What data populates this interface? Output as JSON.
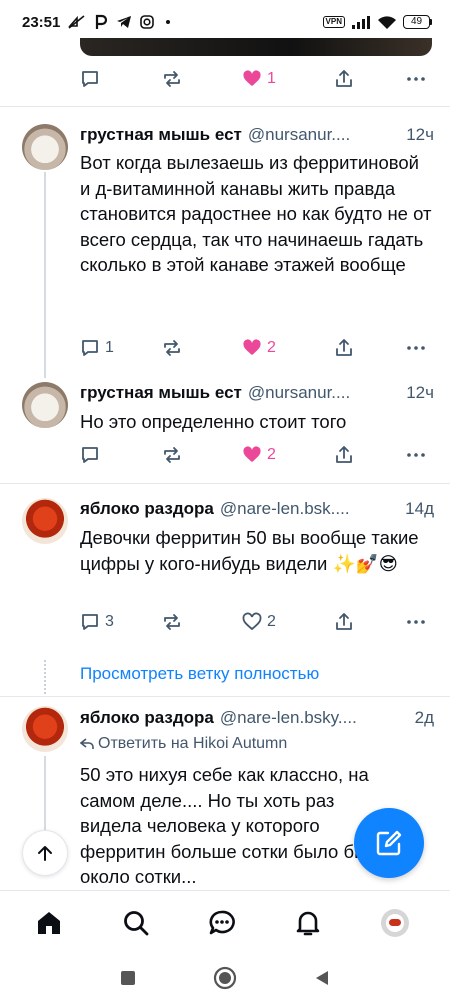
{
  "status_bar": {
    "time": "23:51",
    "vpn": "VPN",
    "battery": "49"
  },
  "posts": [
    {
      "actions": {
        "reply_count": "",
        "repost_count": "",
        "like_count": "1",
        "liked": true
      }
    },
    {
      "author": "грустная мышь ест",
      "handle": "@nursanur....",
      "time": "12ч",
      "text": "Вот когда вылезаешь из ферритиновой и д-витаминной канавы жить правда становится радостнее но как будто не от всего сердца, так что начинаешь гадать сколько в этой канаве этажей вообще",
      "actions": {
        "reply_count": "1",
        "repost_count": "",
        "like_count": "2",
        "liked": true
      }
    },
    {
      "author": "грустная мышь ест",
      "handle": "@nursanur....",
      "time": "12ч",
      "text": "Но это определенно стоит того",
      "actions": {
        "reply_count": "",
        "repost_count": "",
        "like_count": "2",
        "liked": true
      }
    },
    {
      "author": "яблоко раздора",
      "handle": "@nare-len.bsk....",
      "time": "14д",
      "text": "Девочки ферритин 50 вы вообще такие цифры у кого-нибудь видели ✨💅😎",
      "actions": {
        "reply_count": "3",
        "repost_count": "",
        "like_count": "2",
        "liked": false
      }
    },
    {
      "author": "яблоко раздора",
      "handle": "@nare-len.bsky....",
      "time": "2д",
      "reply_to": "Ответить на Hikoi Autumn",
      "text": "50 это нихуя себе как классно, на самом деле.... Но ты хоть раз видела человека у которого ферритин больше сотки было бы около сотки..."
    }
  ],
  "view_thread": "Просмотреть ветку полностью",
  "colors": {
    "accent": "#1083fe",
    "like": "#ec4899",
    "muted": "#42576c"
  },
  "icons": [
    "reply-icon",
    "repost-icon",
    "heart-icon",
    "share-icon",
    "more-icon",
    "compose-icon",
    "arrow-up-icon",
    "home-icon",
    "search-icon",
    "chat-icon",
    "bell-icon"
  ]
}
